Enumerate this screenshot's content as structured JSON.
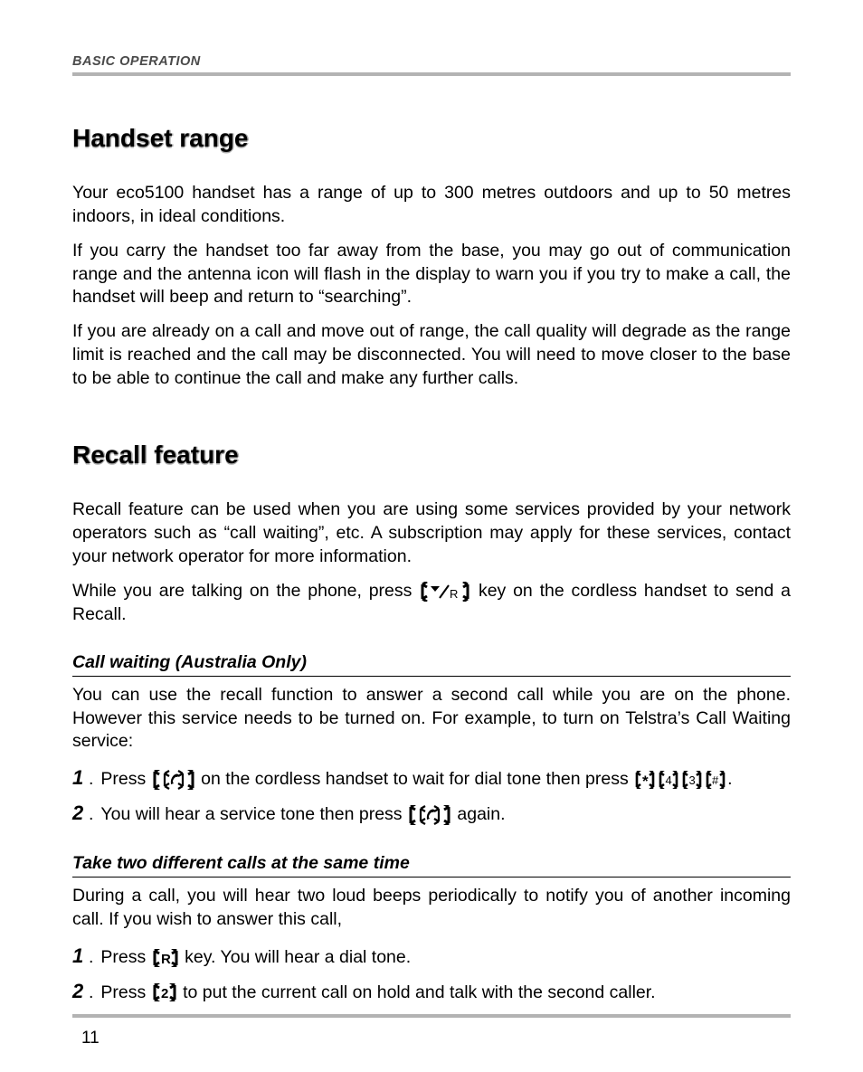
{
  "header": {
    "section_label": "BASIC OPERATION"
  },
  "range": {
    "heading": "Handset range",
    "p1": "Your eco5100 handset has a range of up to 300 metres outdoors and up to 50 metres indoors, in ideal conditions.",
    "p2": "If you carry the handset too far away from the base, you may go out of communication range and the antenna icon will flash in the display to warn you if you try to make a call, the handset will beep and return to “searching”.",
    "p3": "If you are already on a call and move out of range, the call quality will degrade as the range limit is reached and the call may be disconnected. You will need to move closer to the base to be able to continue the call and make any further calls."
  },
  "recall": {
    "heading": "Recall feature",
    "p1": "Recall feature can be used when you are using some services provided by your network operators such as “call waiting”, etc. A subscription may apply for these services, contact your network operator for more information.",
    "p2a": "While you are talking on the phone, press ",
    "p2b": " key on the cordless handset to send a Recall."
  },
  "callwaiting": {
    "heading": "Call waiting (Australia Only)",
    "p1": "You can use the recall function to answer a second call while you are on the phone. However this service needs to be turned on. For example, to turn on Telstra’s Call Waiting service:",
    "step1_num": "1",
    "step1_a": "Press ",
    "step1_b": " on the cordless handset to wait for dial tone then press ",
    "step1_c": ".",
    "step2_num": "2",
    "step2_a": "You will hear a service tone then press ",
    "step2_b": " again."
  },
  "twocalls": {
    "heading": "Take two different calls at the same time",
    "p1": "During a call, you will hear two loud beeps periodically to notify you of another incoming call. If you wish to answer this call,",
    "step1_num": "1",
    "step1_a": "Press ",
    "step1_b": " key. You will hear a dial tone.",
    "step2_num": "2",
    "step2_a": "Press ",
    "step2_b": " to put the current call on hold and talk with the second caller."
  },
  "keys": {
    "recall": "◄/R",
    "star": "*",
    "four": "4",
    "three": "3",
    "hash": "#",
    "R": "R",
    "two": "2"
  },
  "page_number": "11"
}
